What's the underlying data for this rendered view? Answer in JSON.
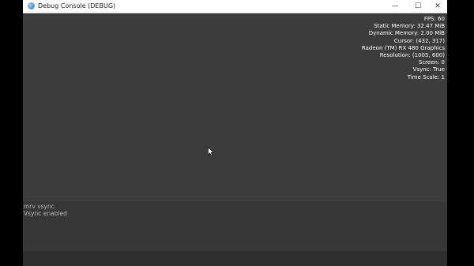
{
  "window": {
    "title": "Debug Console (DEBUG)",
    "minimize_glyph": "—",
    "maximize_glyph": "☐",
    "close_glyph": "✕"
  },
  "stats": {
    "fps": "FPS: 60",
    "static_memory": "Static Memory: 32.47 MiB",
    "dynamic_memory": "Dynamic Memory: 2.00 MiB",
    "cursor": "Cursor: (432, 317)",
    "gpu": "Radeon (TM) RX 480 Graphics",
    "resolution": "Resolution: (1005, 600)",
    "screen": "Screen: 0",
    "vsync": "Vsync: True",
    "time_scale": "Time Scale: 1"
  },
  "console": {
    "log": [
      "mrv vsync",
      "Vsync enabled"
    ],
    "input_value": ""
  },
  "icons": {
    "app": "app-icon",
    "cursor": "mouse-pointer-icon"
  }
}
